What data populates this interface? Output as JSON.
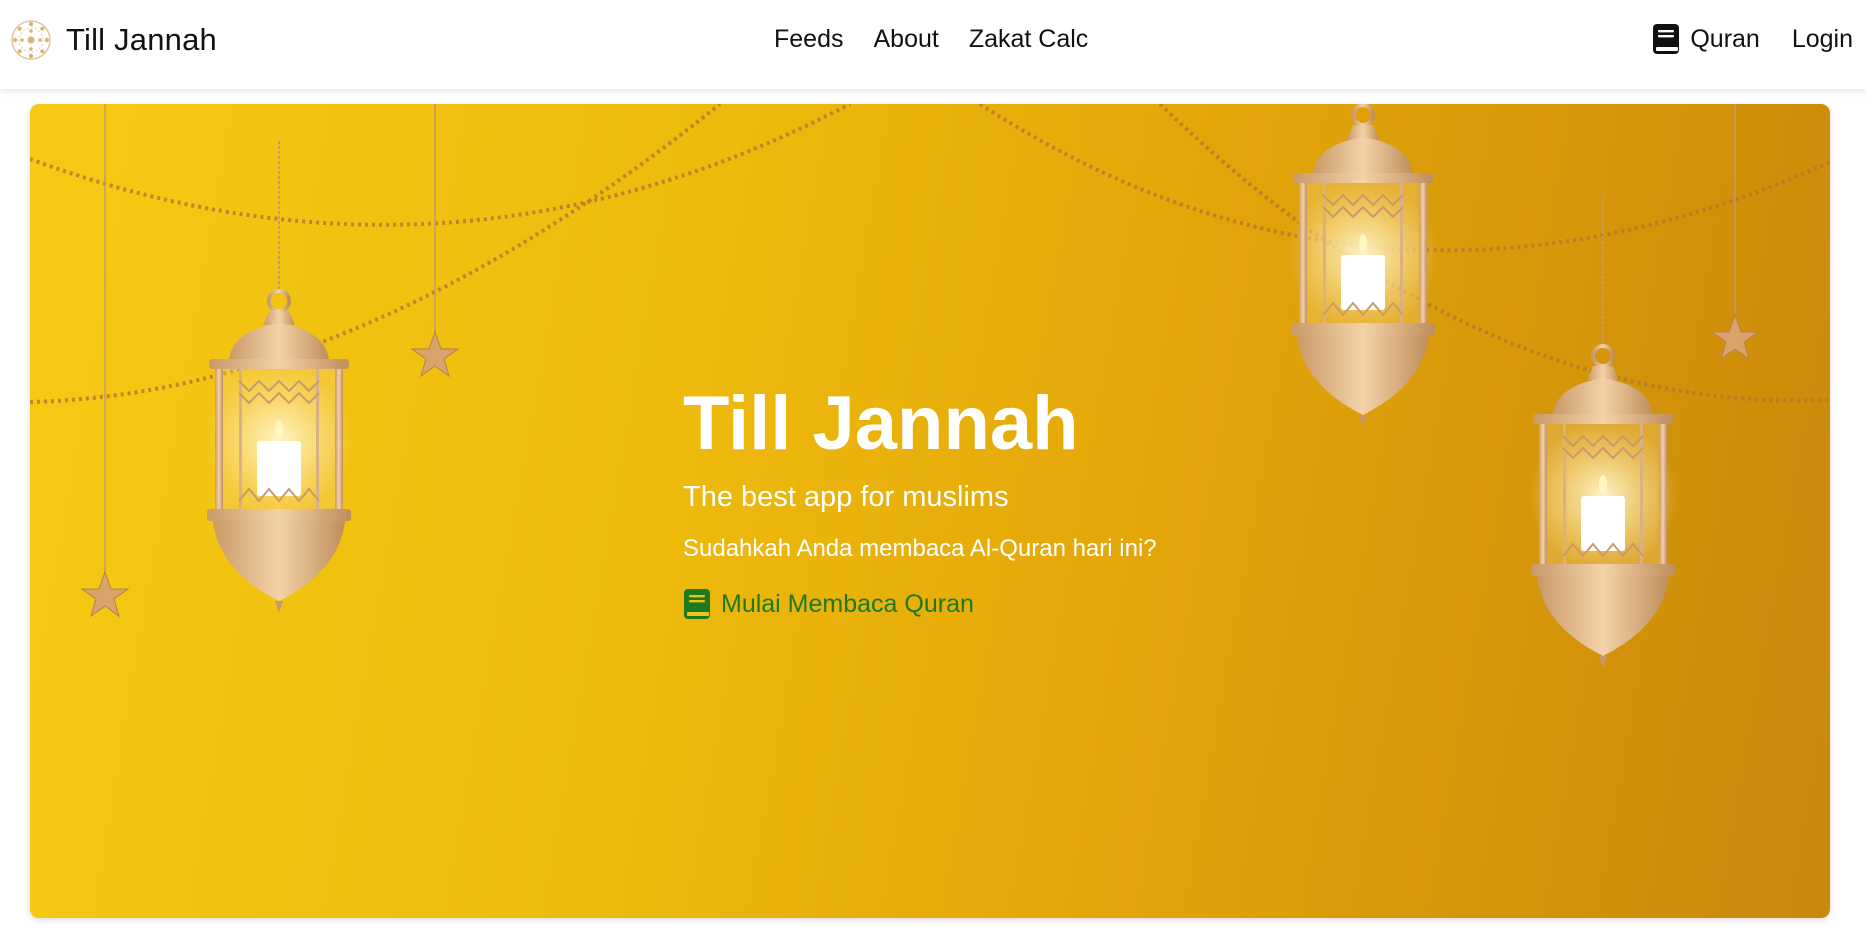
{
  "brand": {
    "name": "Till Jannah",
    "logo_icon": "mandala-logo-icon"
  },
  "nav": {
    "center_links": [
      "Feeds",
      "About",
      "Zakat Calc"
    ],
    "quran_label": "Quran",
    "login_label": "Login",
    "quran_icon": "book-icon"
  },
  "hero": {
    "title": "Till Jannah",
    "subtitle": "The best app for muslims",
    "question": "Sudahkah Anda membaca Al-Quran hari ini?",
    "cta_label": "Mulai Membaca Quran",
    "cta_icon": "book-icon",
    "cta_color": "#1c7a1c",
    "background_colors": [
      "#f7c914",
      "#c9880b"
    ],
    "decorations": [
      "lantern-icon",
      "star-icon",
      "bead-garland"
    ]
  }
}
